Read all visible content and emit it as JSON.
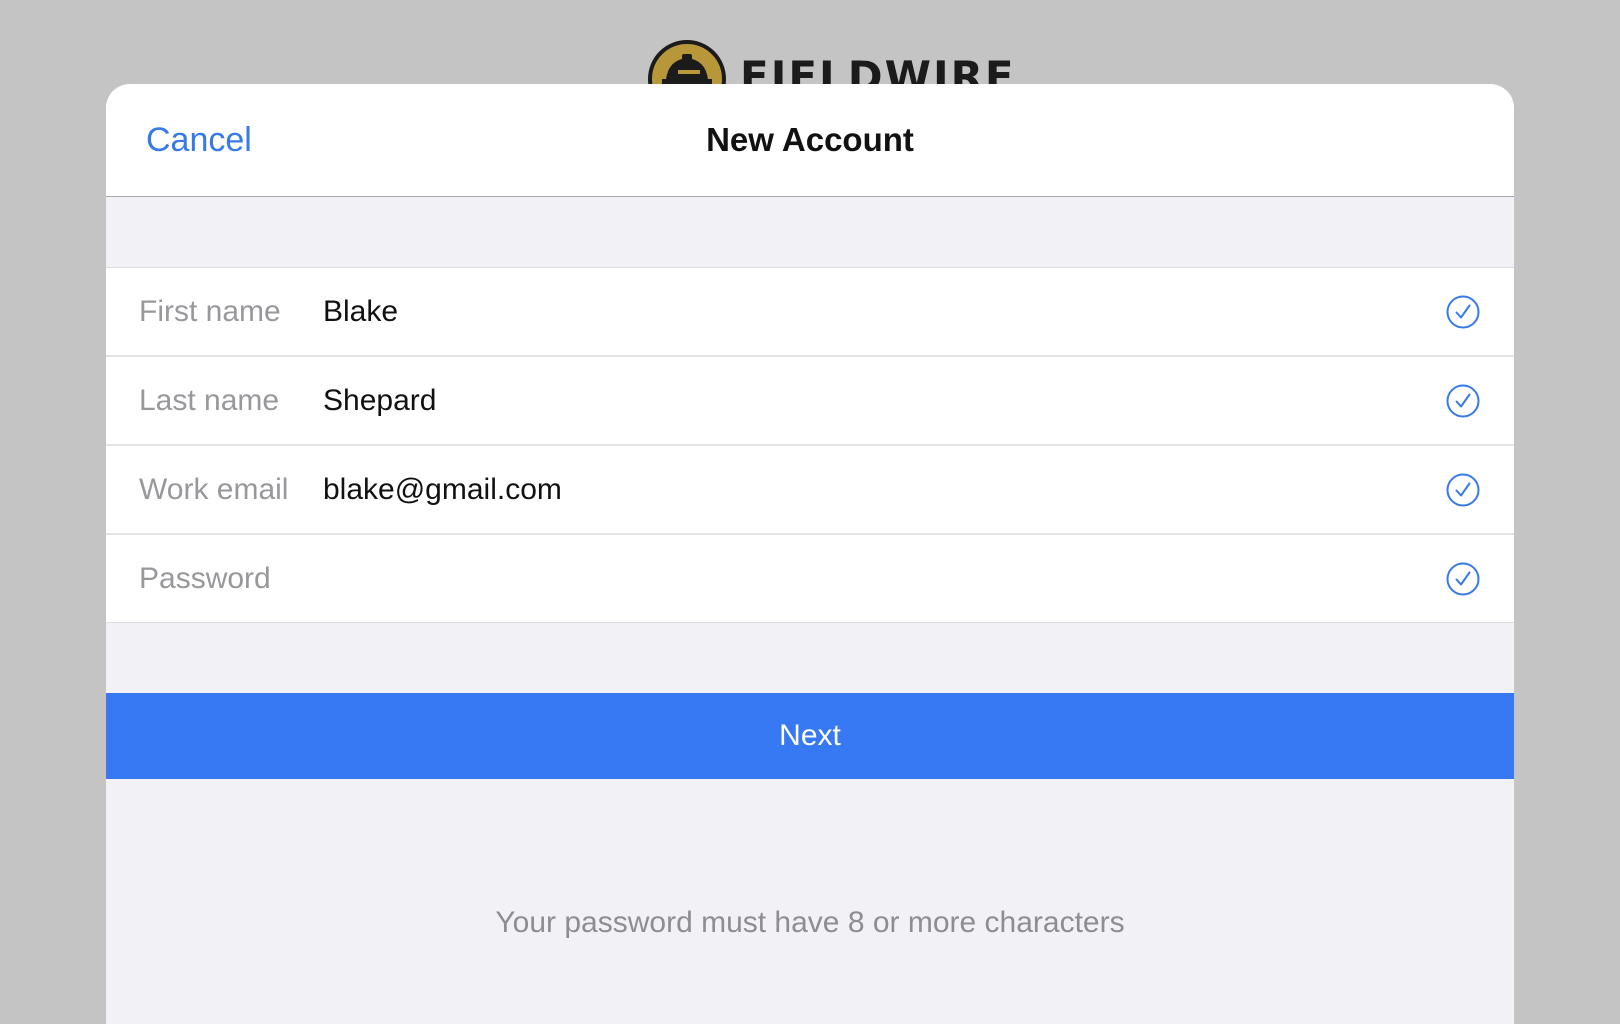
{
  "brand": {
    "wordmark": "FIELDWIRE",
    "logo_icon": "hardhat-logo-icon",
    "logo_color": "#b8963a"
  },
  "nav": {
    "cancel_label": "Cancel",
    "title": "New Account"
  },
  "form": {
    "fields": [
      {
        "label": "First name",
        "value": "Blake",
        "validated": true
      },
      {
        "label": "Last name",
        "value": "Shepard",
        "validated": true
      },
      {
        "label": "Work email",
        "value": "blake@gmail.com",
        "validated": true
      },
      {
        "label": "Password",
        "value": "",
        "validated": true
      }
    ],
    "check_icon": "checkmark-circle-icon"
  },
  "actions": {
    "next_label": "Next"
  },
  "hint": "Your password must have 8 or more characters",
  "colors": {
    "accent": "#3779e5",
    "button": "#3779f2",
    "backdrop": "#c3c4c3",
    "sheet_background": "#f1f1f6"
  }
}
